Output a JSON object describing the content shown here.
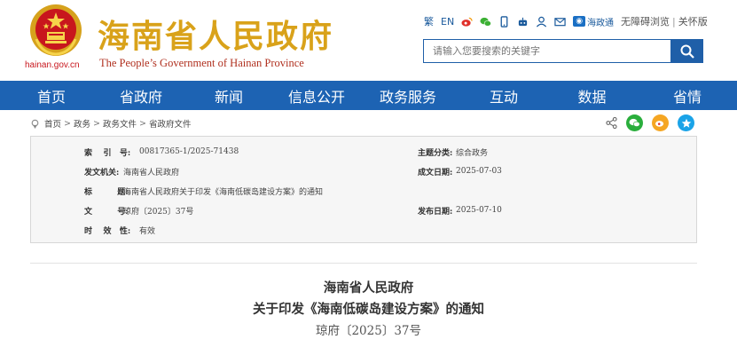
{
  "header": {
    "site_title": "海南省人民政府",
    "site_subtitle": "The People’s Government  of Hainan Province",
    "domain": "hainan.gov.cn",
    "tools": {
      "traditional": "繁",
      "english": "EN",
      "app_badge": "海政通",
      "accessibility": "无障碍浏览",
      "separator": "|",
      "elderly": "关怀版"
    },
    "search": {
      "placeholder": "请输入您要搜索的关键字"
    }
  },
  "nav": {
    "items": [
      "首页",
      "省政府",
      "新闻",
      "信息公开",
      "政务服务",
      "互动",
      "数据",
      "省情"
    ]
  },
  "breadcrumb": {
    "items": [
      "首页",
      "政务",
      "政务文件",
      "省政府文件"
    ],
    "separator": ">"
  },
  "meta": {
    "index_label": "索    引   号:",
    "index_value": "00817365-1/2025-71438",
    "topic_label": "主题分类:",
    "topic_value": "综合政务",
    "issuer_label": "发文机关:",
    "issuer_value": "海南省人民政府",
    "created_label": "成文日期:",
    "created_value": "2025-07-03",
    "title_label": "标         题:",
    "title_value": "海南省人民政府关于印发《海南低碳岛建设方案》的通知",
    "docno_label": "文         号:",
    "docno_value": "琼府〔2025〕37号",
    "published_label": "发布日期:",
    "published_value": "2025-07-10",
    "validity_label": "时    效   性:",
    "validity_value": "有效"
  },
  "document": {
    "issuer": "海南省人民政府",
    "title": "关于印发《海南低碳岛建设方案》的通知",
    "number": "琼府〔2025〕37号"
  },
  "colors": {
    "nav_bg": "#1d63b3",
    "title_gold": "#d9a21a",
    "subtitle_red": "#b0301f",
    "link_blue": "#1a5a9c"
  },
  "icons": {
    "mobile": "mobile-icon",
    "weibo": "weibo-icon",
    "wechat": "wechat-icon",
    "robot": "robot-icon",
    "user": "user-icon",
    "mail": "mail-icon",
    "search": "search-icon",
    "home": "home-icon",
    "share": "share-icon",
    "favorite": "star-icon"
  }
}
